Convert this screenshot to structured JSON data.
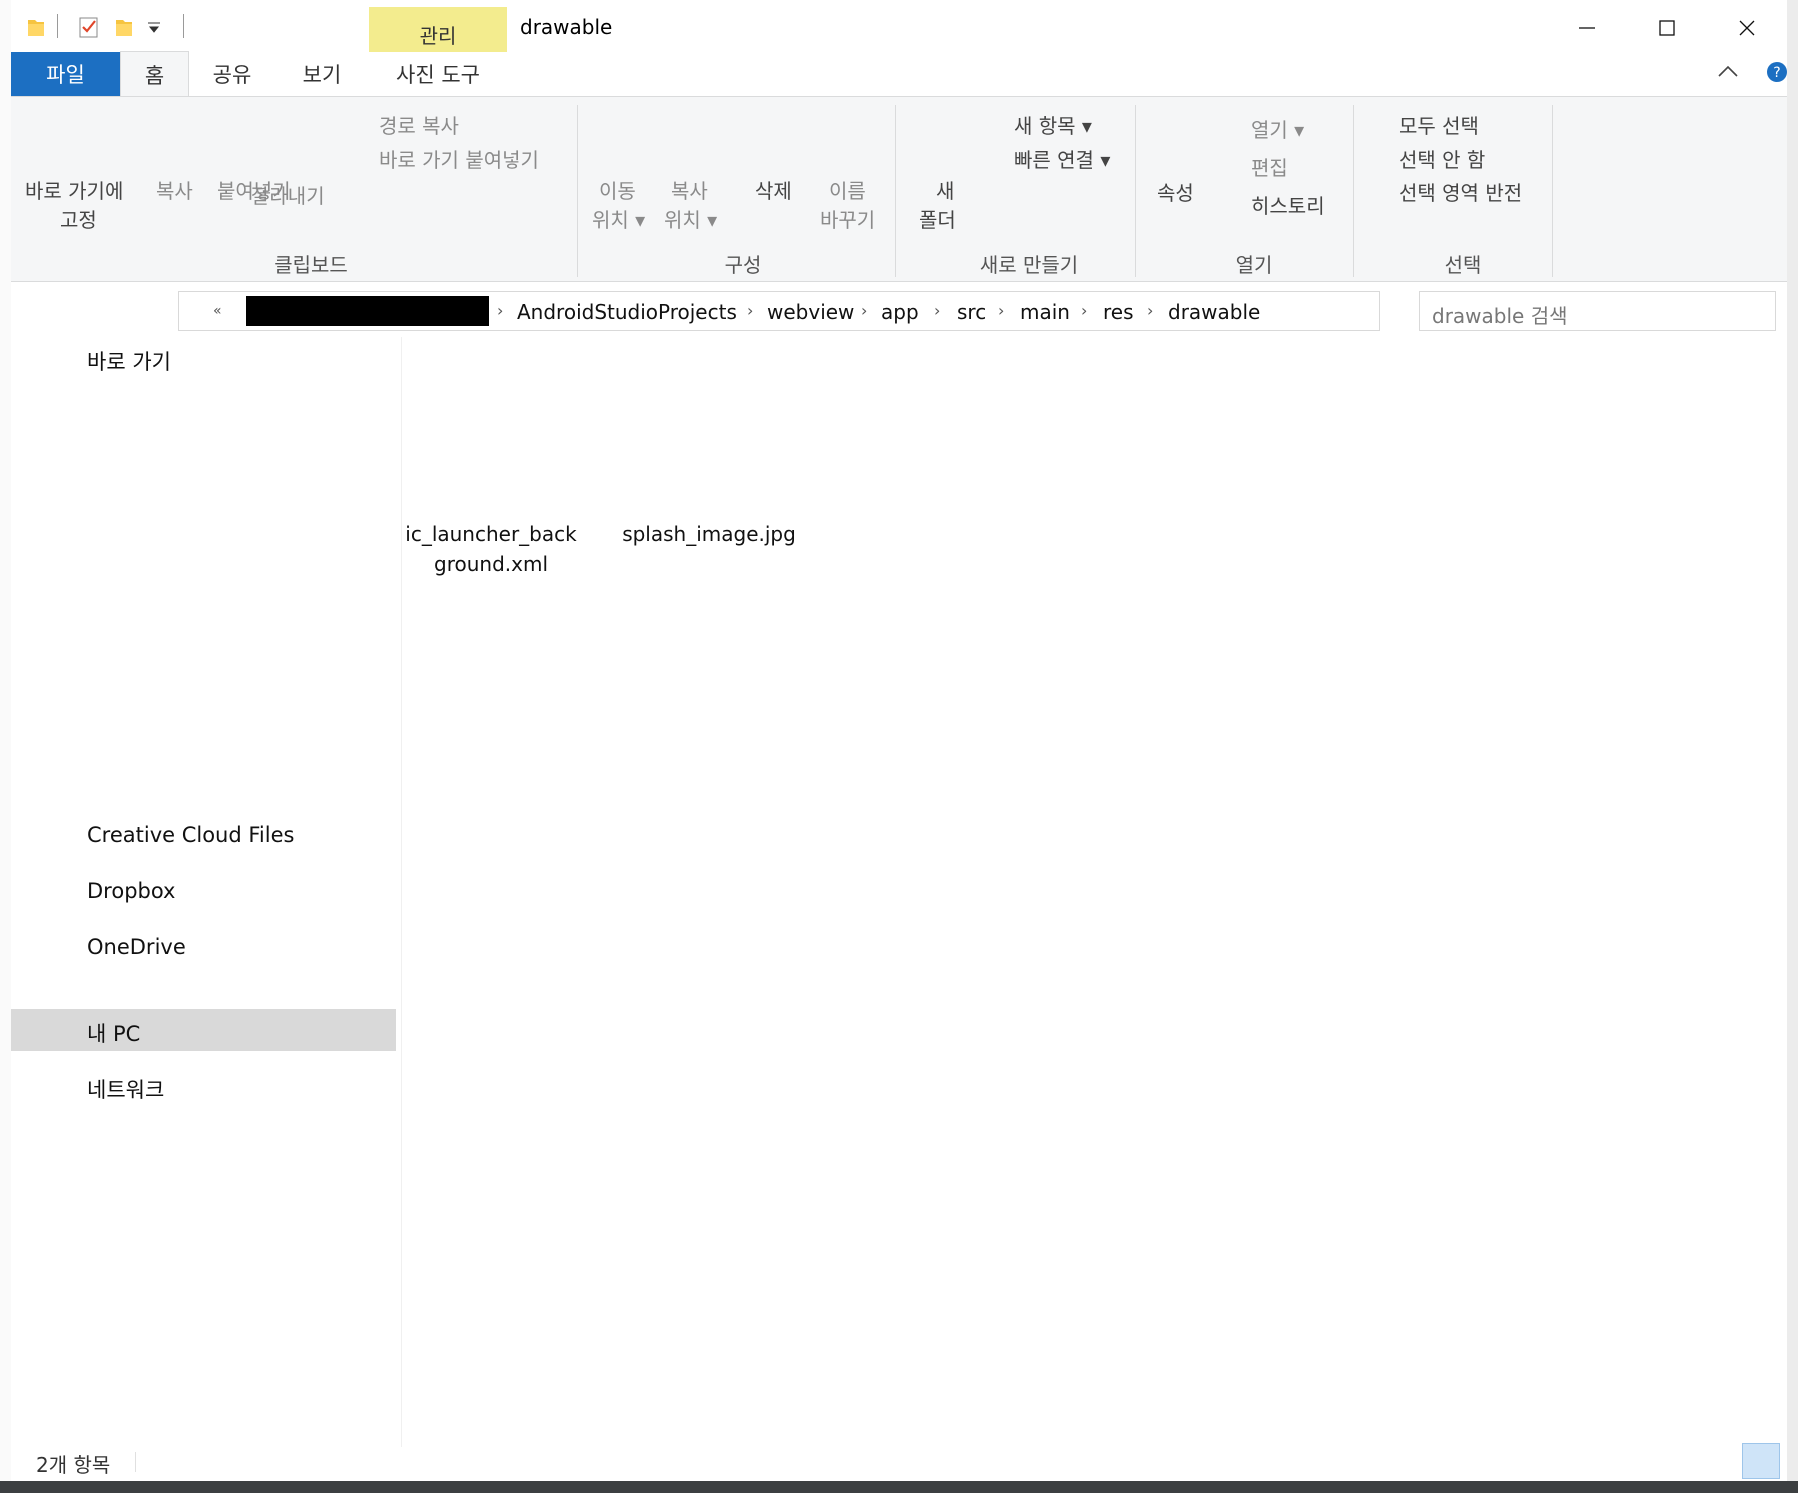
{
  "window": {
    "title": "drawable",
    "context_tab": "관리",
    "controls": {
      "minimize": "minimize-icon",
      "maximize": "maximize-icon",
      "close": "close-icon"
    }
  },
  "ribbon_tabs": [
    {
      "label": "파일"
    },
    {
      "label": "홈"
    },
    {
      "label": "공유"
    },
    {
      "label": "보기"
    },
    {
      "label": "사진 도구"
    }
  ],
  "ribbon": {
    "clipboard": {
      "group": "클립보드",
      "pin": [
        "바로 가기에",
        "고정"
      ],
      "copy": "복사",
      "paste": "붙여넣기",
      "copy_path": "경로 복사",
      "paste_shortcut": "바로 가기 붙여넣기",
      "cut": "잘라내기"
    },
    "organize": {
      "group": "구성",
      "move_to": [
        "이동",
        "위치 ▾"
      ],
      "copy_to": [
        "복사",
        "위치 ▾"
      ],
      "delete": "삭제",
      "rename": [
        "이름",
        "바꾸기"
      ]
    },
    "new": {
      "group": "새로 만들기",
      "new_folder": [
        "새",
        "폴더"
      ],
      "new_item": "새 항목 ▾",
      "easy_access": "빠른 연결 ▾"
    },
    "open": {
      "group": "열기",
      "properties": "속성",
      "open": "열기 ▾",
      "edit": "편집",
      "history": "히스토리"
    },
    "select": {
      "group": "선택",
      "select_all": "모두 선택",
      "select_none": "선택 안 함",
      "invert": "선택 영역 반전"
    }
  },
  "address": {
    "overflow": "«",
    "crumbs": [
      "AndroidStudioProjects",
      "webview",
      "app",
      "src",
      "main",
      "res",
      "drawable"
    ],
    "search_placeholder": "drawable 검색"
  },
  "nav_pane": {
    "quick_access": "바로 가기",
    "items": [
      {
        "label": "Creative Cloud Files"
      },
      {
        "label": "Dropbox"
      },
      {
        "label": "OneDrive"
      },
      {
        "label": "내 PC",
        "selected": true
      },
      {
        "label": "네트워크"
      }
    ]
  },
  "files": [
    {
      "name_line1": "ic_launcher_back",
      "name_line2": "ground.xml"
    },
    {
      "name_line1": "splash_image.jpg"
    }
  ],
  "status": {
    "count": "2개 항목"
  },
  "colors": {
    "file_tab": "#1c6fc2",
    "context_tab": "#f3ec8e",
    "selection": "#d9d9d9",
    "accent": "#2d7cd6"
  }
}
